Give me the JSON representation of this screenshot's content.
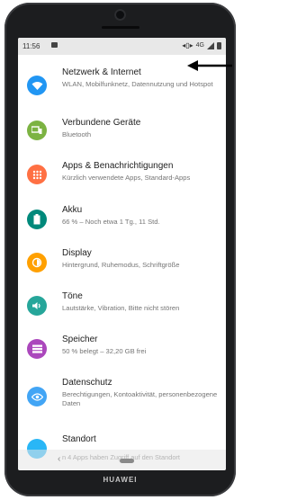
{
  "status_bar": {
    "time": "11:56",
    "network": "4G"
  },
  "settings": [
    {
      "title": "Netzwerk & Internet",
      "subtitle": "WLAN, Mobilfunknetz, Datennutzung und Hotspot",
      "icon": "wifi-icon",
      "color": "#2196f3"
    },
    {
      "title": "Verbundene Geräte",
      "subtitle": "Bluetooth",
      "icon": "devices-icon",
      "color": "#7cb342"
    },
    {
      "title": "Apps & Benachrichtigungen",
      "subtitle": "Kürzlich verwendete Apps, Standard-Apps",
      "icon": "apps-icon",
      "color": "#ff7043"
    },
    {
      "title": "Akku",
      "subtitle": "66 % – Noch etwa 1 Tg., 11 Std.",
      "icon": "battery-icon",
      "color": "#00897b"
    },
    {
      "title": "Display",
      "subtitle": "Hintergrund, Ruhemodus, Schriftgröße",
      "icon": "brightness-icon",
      "color": "#ffa000"
    },
    {
      "title": "Töne",
      "subtitle": "Lautstärke, Vibration, Bitte nicht stören",
      "icon": "volume-icon",
      "color": "#26a69a"
    },
    {
      "title": "Speicher",
      "subtitle": "50 % belegt – 32,20 GB frei",
      "icon": "storage-icon",
      "color": "#ab47bc"
    },
    {
      "title": "Datenschutz",
      "subtitle": "Berechtigungen, Kontoaktivität, personenbezogene Daten",
      "icon": "privacy-icon",
      "color": "#42a5f5"
    },
    {
      "title": "Standort",
      "subtitle": "",
      "icon": "location-icon",
      "color": "#29b6f6"
    }
  ],
  "partial_text": "n 4 Apps haben Zugriff auf den Standort",
  "device_brand": "HUAWEI"
}
